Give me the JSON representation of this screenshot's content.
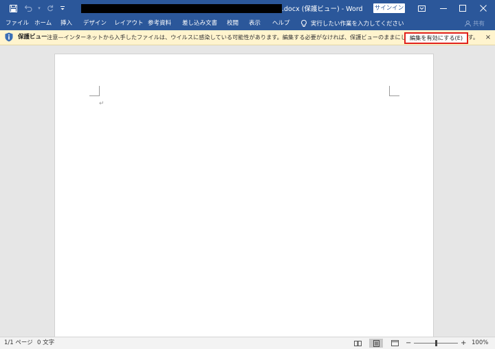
{
  "title_bar": {
    "filename_suffix": ".docx",
    "mode": "(保護ビュー)",
    "separator": "-",
    "app_name": "Word",
    "signin_label": "サインイン",
    "colors": {
      "background": "#2b579a",
      "text": "#ffffff"
    }
  },
  "quick_access": {
    "save_icon": "save-icon",
    "undo_icon": "undo-icon",
    "redo_icon": "redo-icon",
    "customize_icon": "customize-icon"
  },
  "window_controls": {
    "ribbon_display_icon": "ribbon-display-icon",
    "minimize_icon": "minimize-icon",
    "maximize_icon": "maximize-icon",
    "close_icon": "close-icon"
  },
  "menu": {
    "items": [
      "ファイル",
      "ホーム",
      "挿入",
      "デザイン",
      "レイアウト",
      "参考資料",
      "差し込み文書",
      "校閲",
      "表示",
      "ヘルプ"
    ],
    "tell_me_icon": "lightbulb-icon",
    "tell_me": "実行したい作業を入力してください",
    "share_icon": "person-icon",
    "share": "共有"
  },
  "protected_view": {
    "icon": "shield-icon",
    "label": "保護ビュー",
    "message": "注意—インターネットから入手したファイルは、ウイルスに感染している可能性があります。編集する必要がなければ、保護ビューのままにしておくことをお勧めします。",
    "enable_button": "編集を有効にする(E)",
    "close_symbol": "×",
    "colors": {
      "background": "#fff4ce",
      "highlight_border": "#e0201a"
    }
  },
  "document": {
    "paragraph_mark": "↵"
  },
  "status_bar": {
    "page": "1/1 ページ",
    "words": "0 文字",
    "read_mode_icon": "read-mode-icon",
    "print_layout_icon": "print-layout-icon",
    "web_layout_icon": "web-layout-icon",
    "zoom_out": "−",
    "zoom_in": "+",
    "zoom": "100%",
    "zoom_fraction": 0.5
  }
}
